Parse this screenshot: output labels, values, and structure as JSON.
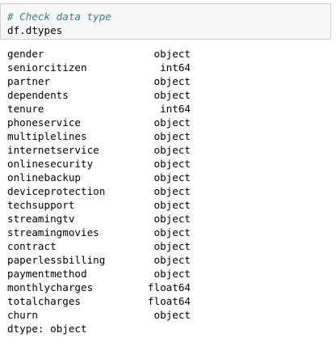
{
  "input_cell": {
    "comment": "# Check data type",
    "code": "df.dtypes"
  },
  "output": {
    "rows": [
      {
        "name": "gender",
        "dtype": "object"
      },
      {
        "name": "seniorcitizen",
        "dtype": "int64"
      },
      {
        "name": "partner",
        "dtype": "object"
      },
      {
        "name": "dependents",
        "dtype": "object"
      },
      {
        "name": "tenure",
        "dtype": "int64"
      },
      {
        "name": "phoneservice",
        "dtype": "object"
      },
      {
        "name": "multiplelines",
        "dtype": "object"
      },
      {
        "name": "internetservice",
        "dtype": "object"
      },
      {
        "name": "onlinesecurity",
        "dtype": "object"
      },
      {
        "name": "onlinebackup",
        "dtype": "object"
      },
      {
        "name": "deviceprotection",
        "dtype": "object"
      },
      {
        "name": "techsupport",
        "dtype": "object"
      },
      {
        "name": "streamingtv",
        "dtype": "object"
      },
      {
        "name": "streamingmovies",
        "dtype": "object"
      },
      {
        "name": "contract",
        "dtype": "object"
      },
      {
        "name": "paperlessbilling",
        "dtype": "object"
      },
      {
        "name": "paymentmethod",
        "dtype": "object"
      },
      {
        "name": "monthlycharges",
        "dtype": "float64"
      },
      {
        "name": "totalcharges",
        "dtype": "float64"
      },
      {
        "name": "churn",
        "dtype": "object"
      }
    ],
    "footer": "dtype: object"
  },
  "colors": {
    "comment": "#408080",
    "cell_background": "#f7f7f7",
    "cell_border": "#cfcfcf"
  }
}
